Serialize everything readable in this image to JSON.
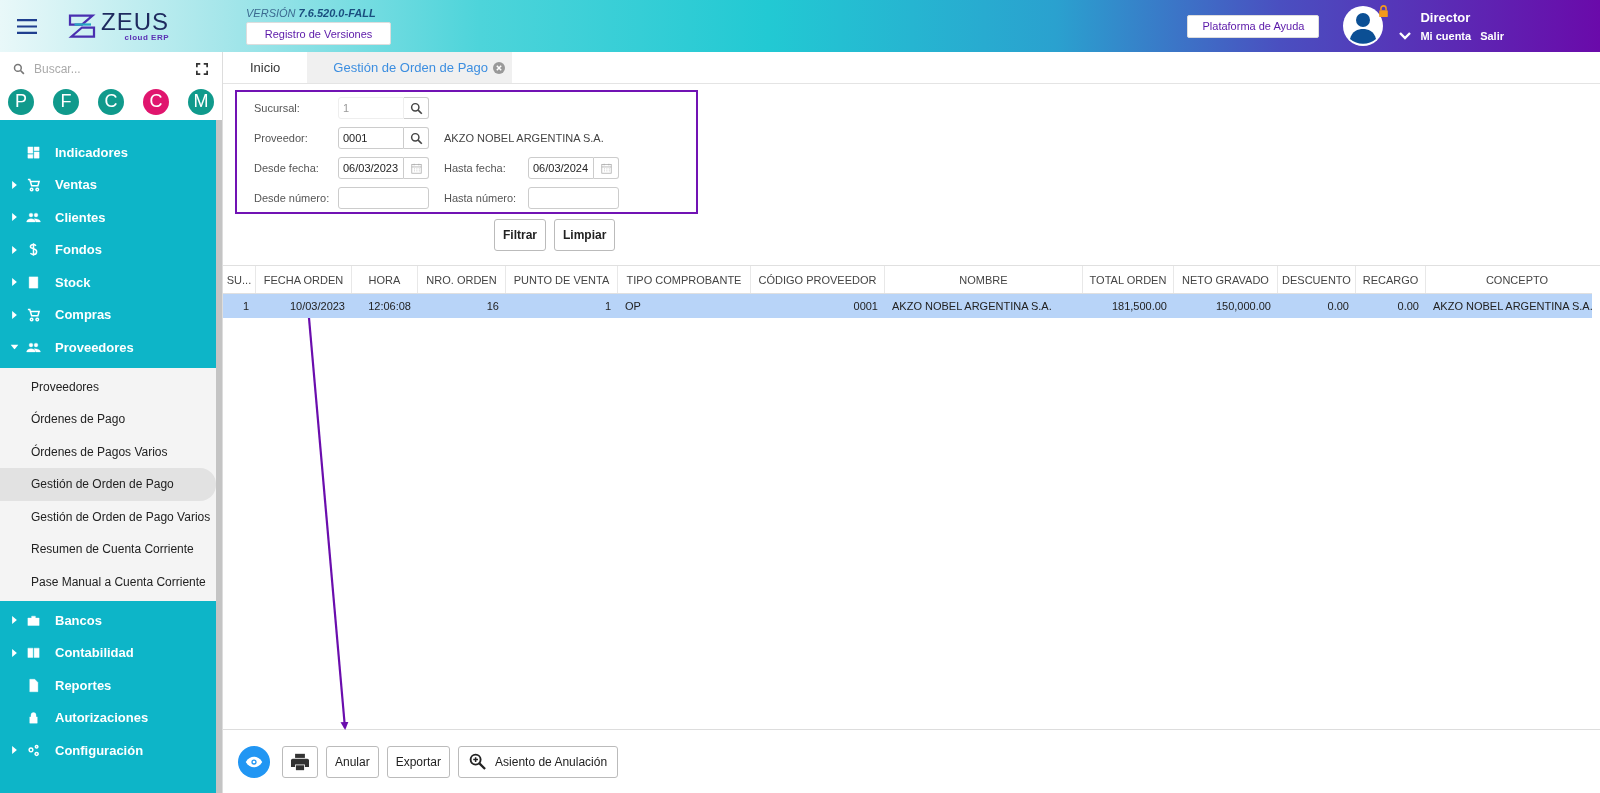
{
  "header": {
    "logo_name": "ZEUS",
    "logo_sub": "cloud ERP",
    "version_label": "VERSIÓN",
    "version": "7.6.520.0-FALL",
    "versions_button": "Registro de Versiones",
    "help_button": "Plataforma de Ayuda",
    "user_role": "Director",
    "account_link": "Mi cuenta",
    "logout_link": "Salir"
  },
  "sidebar": {
    "search": {
      "placeholder": "Buscar..."
    },
    "shortcuts": [
      {
        "letter": "P",
        "color": "#109a8c"
      },
      {
        "letter": "F",
        "color": "#109a8c"
      },
      {
        "letter": "C",
        "color": "#109a8c"
      },
      {
        "letter": "C",
        "color": "#e0156e"
      },
      {
        "letter": "M",
        "color": "#109a8c"
      }
    ],
    "items": [
      {
        "label": "Indicadores",
        "kind": "link"
      },
      {
        "label": "Ventas",
        "kind": "group",
        "expanded": false
      },
      {
        "label": "Clientes",
        "kind": "group",
        "expanded": false
      },
      {
        "label": "Fondos",
        "kind": "group",
        "expanded": false
      },
      {
        "label": "Stock",
        "kind": "group",
        "expanded": false
      },
      {
        "label": "Compras",
        "kind": "group",
        "expanded": false
      },
      {
        "label": "Proveedores",
        "kind": "group",
        "expanded": true,
        "children": [
          {
            "label": "Proveedores",
            "selected": false
          },
          {
            "label": "Órdenes de Pago",
            "selected": false
          },
          {
            "label": "Órdenes de Pagos Varios",
            "selected": false
          },
          {
            "label": "Gestión de Orden de Pago",
            "selected": true
          },
          {
            "label": "Gestión de Orden de Pago Varios",
            "selected": false
          },
          {
            "label": "Resumen de Cuenta Corriente",
            "selected": false
          },
          {
            "label": "Pase Manual a Cuenta Corriente",
            "selected": false
          }
        ]
      },
      {
        "label": "Bancos",
        "kind": "group",
        "expanded": false
      },
      {
        "label": "Contabilidad",
        "kind": "group",
        "expanded": false
      },
      {
        "label": "Reportes",
        "kind": "link"
      },
      {
        "label": "Autorizaciones",
        "kind": "link"
      },
      {
        "label": "Configuración",
        "kind": "group",
        "expanded": false
      }
    ]
  },
  "tabs": [
    {
      "label": "Inicio",
      "selected": false,
      "closable": false
    },
    {
      "label": "Gestión de Orden de Pago",
      "selected": true,
      "closable": true
    }
  ],
  "filter": {
    "rows": [
      {
        "fields": [
          {
            "label": "Sucursal:",
            "value": "1",
            "disabled": true,
            "kind": "search"
          }
        ]
      },
      {
        "fields": [
          {
            "label": "Proveedor:",
            "value": "0001",
            "disabled": false,
            "kind": "search"
          }
        ],
        "note": "AKZO NOBEL ARGENTINA S.A."
      },
      {
        "fields": [
          {
            "label": "Desde fecha:",
            "value": "06/03/2023",
            "disabled": false,
            "kind": "date"
          },
          {
            "label": "Hasta fecha:",
            "value": "06/03/2024",
            "disabled": false,
            "kind": "date"
          }
        ]
      },
      {
        "fields": [
          {
            "label": "Desde número:",
            "disabled": false,
            "kind": "plain"
          },
          {
            "label": "Hasta número:",
            "disabled": false,
            "kind": "plain"
          }
        ]
      }
    ],
    "buttons": [
      "Filtrar",
      "Limpiar"
    ]
  },
  "table": {
    "columns": [
      "SU...",
      "FECHA ORDEN",
      "HORA",
      "NRO. ORDEN",
      "PUNTO DE VENTA",
      "TIPO COMPROBANTE",
      "CÓDIGO PROVEEDOR",
      "NOMBRE",
      "TOTAL ORDEN",
      "NETO GRAVADO",
      "DESCUENTO",
      "RECARGO",
      "CONCEPTO"
    ],
    "rows": [
      {
        "selected": true,
        "cells": [
          "1",
          "10/03/2023",
          "12:06:08",
          "16",
          "1",
          "OP",
          "0001",
          "AKZO NOBEL ARGENTINA S.A.",
          "181,500.00",
          "150,000.00",
          "0.00",
          "0.00",
          "AKZO NOBEL ARGENTINA S.A."
        ]
      }
    ]
  },
  "actions": [
    {
      "kind": "view"
    },
    {
      "kind": "print"
    },
    {
      "kind": "text",
      "label": "Anular"
    },
    {
      "kind": "text",
      "label": "Exportar"
    },
    {
      "kind": "zoom",
      "label": "Asiento de Anulación"
    }
  ]
}
